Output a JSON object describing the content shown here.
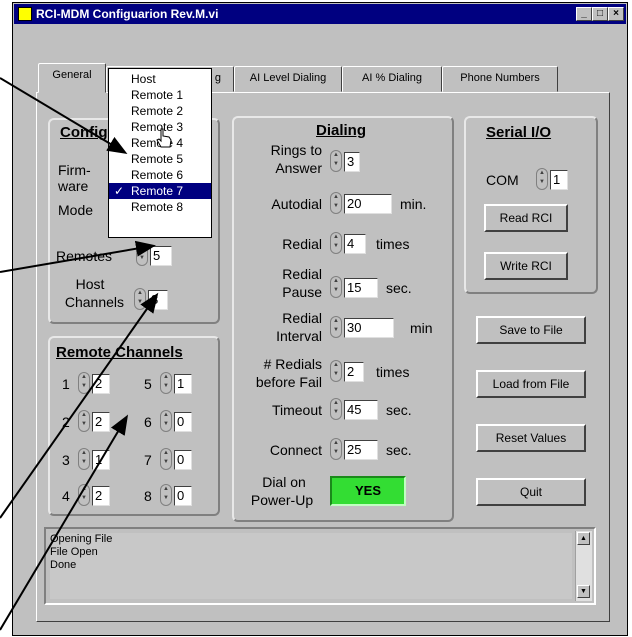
{
  "window": {
    "title": "RCI-MDM Configuarion Rev.M.vi"
  },
  "tabs": [
    "General",
    "Lamp Dialing",
    "AI Level Dialing",
    "AI % Dialing",
    "Phone Numbers"
  ],
  "tab_visible_fragment": "g",
  "dropdown": {
    "items": [
      "Host",
      "Remote 1",
      "Remote 2",
      "Remote 3",
      "Remote 4",
      "Remote 5",
      "Remote 6",
      "Remote 7",
      "Remote 8"
    ],
    "selected": "Remote 7",
    "check": "✓"
  },
  "config": {
    "header": "Config",
    "firmware_label_1": "Firm-",
    "firmware_label_2": "ware",
    "mode_label": "Mode",
    "remotes_label": "Remotes",
    "remotes_value": "5",
    "host_channels_label_1": "Host",
    "host_channels_label_2": "Channels",
    "host_channels_value": "8"
  },
  "remote_channels": {
    "header": "Remote Channels",
    "channels": [
      {
        "n": "1",
        "v": "2"
      },
      {
        "n": "5",
        "v": "1"
      },
      {
        "n": "2",
        "v": "2"
      },
      {
        "n": "6",
        "v": "0"
      },
      {
        "n": "3",
        "v": "1"
      },
      {
        "n": "7",
        "v": "0"
      },
      {
        "n": "4",
        "v": "2"
      },
      {
        "n": "8",
        "v": "0"
      }
    ]
  },
  "dialing": {
    "header": "Dialing",
    "rings_label_1": "Rings to",
    "rings_label_2": "Answer",
    "rings_value": "3",
    "autodial_label": "Autodial",
    "autodial_value": "20",
    "autodial_unit": "min.",
    "redial_label": "Redial",
    "redial_value": "4",
    "redial_unit": "times",
    "redial_pause_1": "Redial",
    "redial_pause_2": "Pause",
    "redial_pause_value": "15",
    "redial_pause_unit": "sec.",
    "redial_interval_1": "Redial",
    "redial_interval_2": "Interval",
    "redial_interval_value": "30",
    "redial_interval_unit": "min",
    "redials_fail_1": "# Redials",
    "redials_fail_2": "before Fail",
    "redials_fail_value": "2",
    "redials_fail_unit": "times",
    "timeout_label": "Timeout",
    "timeout_value": "45",
    "timeout_unit": "sec.",
    "connect_label": "Connect",
    "connect_value": "25",
    "connect_unit": "sec.",
    "dial_power_1": "Dial on",
    "dial_power_2": "Power-Up",
    "dial_power_value": "YES"
  },
  "serial": {
    "header": "Serial I/O",
    "com_label": "COM",
    "com_value": "1",
    "read_button": "Read RCI",
    "write_button": "Write RCI"
  },
  "buttons": {
    "save": "Save to File",
    "load": "Load from File",
    "reset": "Reset Values",
    "quit": "Quit"
  },
  "log": {
    "lines": [
      "Opening File",
      "File Open",
      "Done"
    ]
  },
  "colors": {
    "titlebar": "#000080",
    "led_on": "#33dd33",
    "face": "#c0c0c0"
  }
}
